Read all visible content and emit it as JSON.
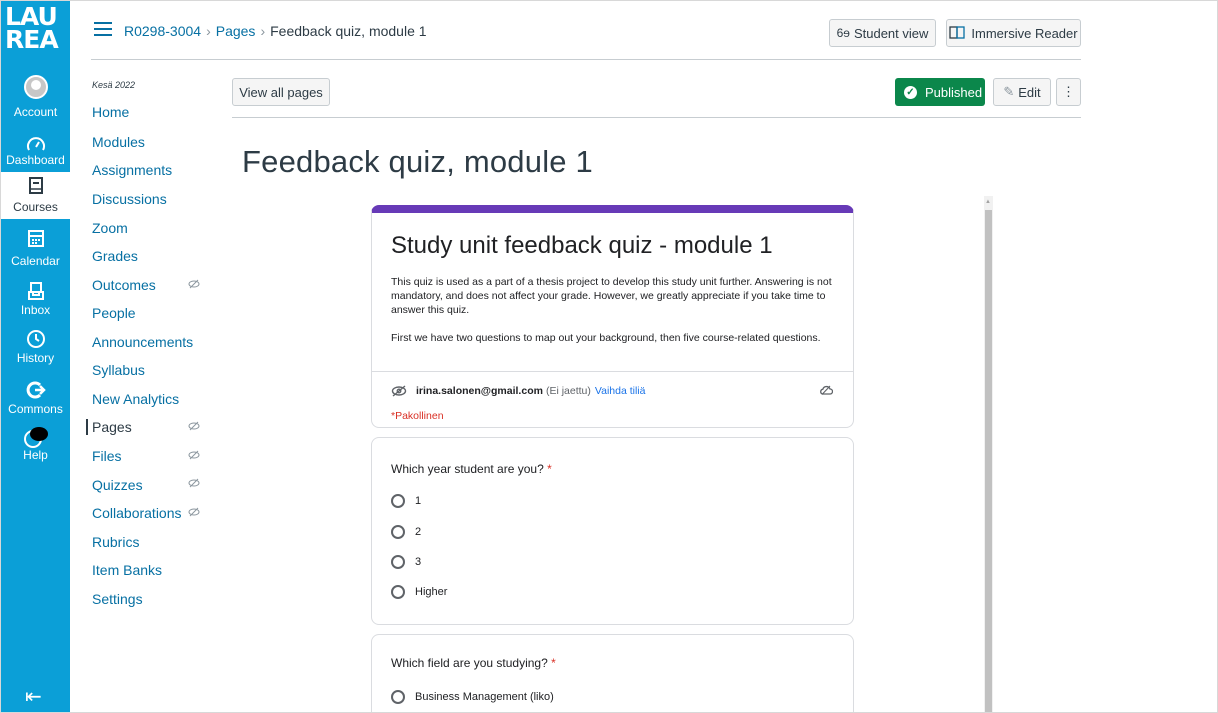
{
  "logo": {
    "line1": "LAU",
    "line2": "REA"
  },
  "global_nav": [
    {
      "id": "account",
      "label": "Account",
      "icon": "avatar-icon"
    },
    {
      "id": "dashboard",
      "label": "Dashboard",
      "icon": "dashboard-icon"
    },
    {
      "id": "courses",
      "label": "Courses",
      "icon": "courses-icon",
      "active": true
    },
    {
      "id": "calendar",
      "label": "Calendar",
      "icon": "calendar-icon"
    },
    {
      "id": "inbox",
      "label": "Inbox",
      "icon": "inbox-icon"
    },
    {
      "id": "history",
      "label": "History",
      "icon": "clock-icon"
    },
    {
      "id": "commons",
      "label": "Commons",
      "icon": "commons-icon"
    },
    {
      "id": "help",
      "label": "Help",
      "icon": "help-icon"
    }
  ],
  "breadcrumb": {
    "course": "R0298-3004",
    "section": "Pages",
    "current": "Feedback quiz, module 1"
  },
  "header_buttons": {
    "student_view": "Student view",
    "immersive_reader": "Immersive Reader"
  },
  "course_nav": {
    "term": "Kesä 2022",
    "items": [
      {
        "label": "Home"
      },
      {
        "label": "Modules"
      },
      {
        "label": "Assignments"
      },
      {
        "label": "Discussions"
      },
      {
        "label": "Zoom"
      },
      {
        "label": "Grades"
      },
      {
        "label": "Outcomes",
        "hidden": true
      },
      {
        "label": "People"
      },
      {
        "label": "Announcements"
      },
      {
        "label": "Syllabus"
      },
      {
        "label": "New Analytics"
      },
      {
        "label": "Pages",
        "hidden": true,
        "active": true
      },
      {
        "label": "Files",
        "hidden": true
      },
      {
        "label": "Quizzes",
        "hidden": true
      },
      {
        "label": "Collaborations",
        "hidden": true
      },
      {
        "label": "Rubrics"
      },
      {
        "label": "Item Banks"
      },
      {
        "label": "Settings"
      }
    ]
  },
  "toolbar": {
    "view_all": "View all pages",
    "published": "Published",
    "edit": "Edit",
    "more": "⋮"
  },
  "page_title": "Feedback quiz, module 1",
  "form": {
    "accent_color": "#673ab7",
    "title": "Study unit feedback quiz - module 1",
    "description_1": "This quiz is used as a part of a thesis project to develop this study unit further. Answering is not mandatory, and does not affect your grade. However, we greatly appreciate if you take time to answer this quiz.",
    "description_2": "First we have two questions to map out your background, then five course-related questions.",
    "account_email": "irina.salonen@gmail.com",
    "account_shared": "(Ei jaettu)",
    "switch_account": "Vaihda tiliä",
    "required_note": "*Pakollinen",
    "questions": [
      {
        "title": "Which year student are you?",
        "star": "*",
        "options": [
          "1",
          "2",
          "3",
          "Higher"
        ]
      },
      {
        "title": "Which field are you studying?",
        "star": "*",
        "options": [
          "Business Management (liko)"
        ]
      }
    ]
  }
}
